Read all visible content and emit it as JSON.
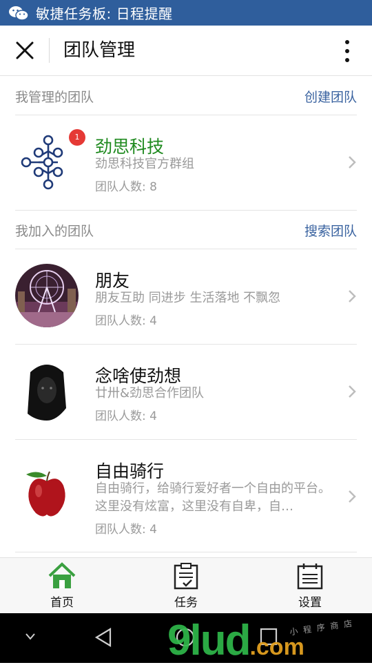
{
  "status_bar": {
    "app_title": "敏捷任务板: 日程提醒"
  },
  "header": {
    "title": "团队管理"
  },
  "managed_section": {
    "label": "我管理的团队",
    "action": "创建团队"
  },
  "managed_teams": [
    {
      "name": "劲思科技",
      "desc": "劲思科技官方群组",
      "count": "团队人数: 8",
      "badge": "1"
    }
  ],
  "joined_section": {
    "label": "我加入的团队",
    "action": "搜索团队"
  },
  "joined_teams": [
    {
      "name": "朋友",
      "desc": "朋友互助 同进步 生活落地 不飘忽",
      "count": "团队人数: 4"
    },
    {
      "name": "念啥使劲想",
      "desc": "廿卅&劲思合作团队",
      "count": "团队人数: 4"
    },
    {
      "name": "自由骑行",
      "desc": "自由骑行，给骑行爱好者一个自由的平台。这里没有炫富，这里没有自卑，自…",
      "count": "团队人数: 4"
    }
  ],
  "tabs": [
    {
      "label": "首页",
      "icon": "home-icon"
    },
    {
      "label": "任务",
      "icon": "clipboard-icon"
    },
    {
      "label": "设置",
      "icon": "calendar-icon"
    }
  ],
  "watermark": {
    "main": "9lud",
    "suffix": ".com",
    "tag": "小 程 序 商 店"
  },
  "colors": {
    "status_bar": "#2f5e9c",
    "link": "#3a63a0",
    "accent_green": "#1f8a1f",
    "badge": "#e53935"
  }
}
